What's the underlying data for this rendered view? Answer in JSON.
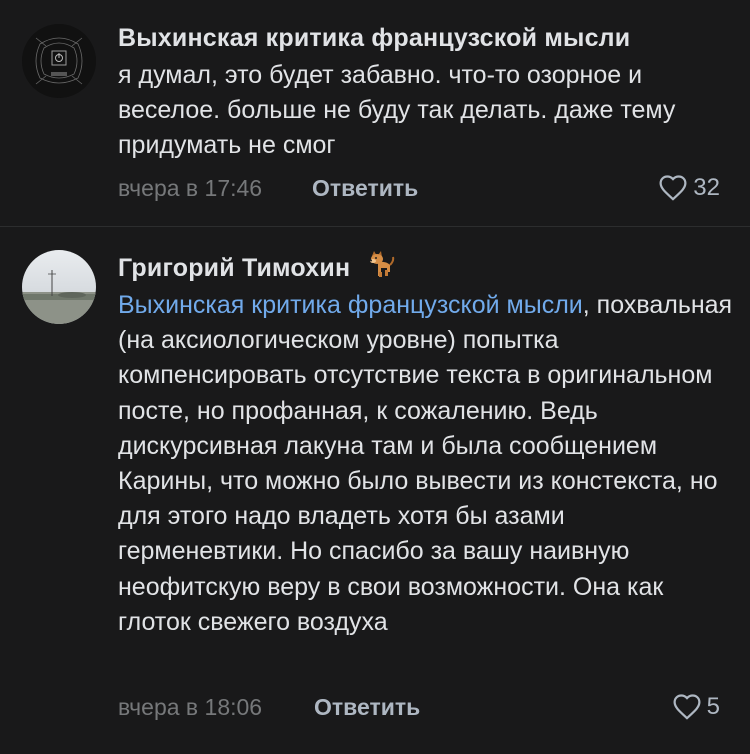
{
  "comments": [
    {
      "author": "Выхинская критика французской мысли",
      "avatar_icon": "logo-avatar",
      "text": "я думал, это будет забавно. что-то озорное и веселое. больше не буду так делать. даже тему придумать не смог",
      "time": "вчера в 17:46",
      "reply_label": "Ответить",
      "likes": "32"
    },
    {
      "author": "Григорий Тимохин",
      "author_badge_icon": "dog-emoji",
      "avatar_icon": "landscape-photo-avatar",
      "mention": "Выхинская критика французской мысли",
      "text": ", похвальная (на аксиологическом уровне) попытка компенсировать отсутствие текста в оригинальном посте, но профанная, к сожалению. Ведь дискурсивная лакуна там и была сообщением Карины, что можно было вывести из констекста, но для этого надо владеть хотя бы азами герменевтики. Но спасибо за вашу наивную неофитскую веру в свои возможности. Она как глоток свежего воздуха",
      "time": "вчера в 18:06",
      "reply_label": "Ответить",
      "likes": "5"
    }
  ],
  "colors": {
    "background": "#19191a",
    "text": "#e1e3e6",
    "secondary": "#76787a",
    "action": "#aeb7c2",
    "mention": "#71aaeb",
    "divider": "#2c2d2e"
  }
}
